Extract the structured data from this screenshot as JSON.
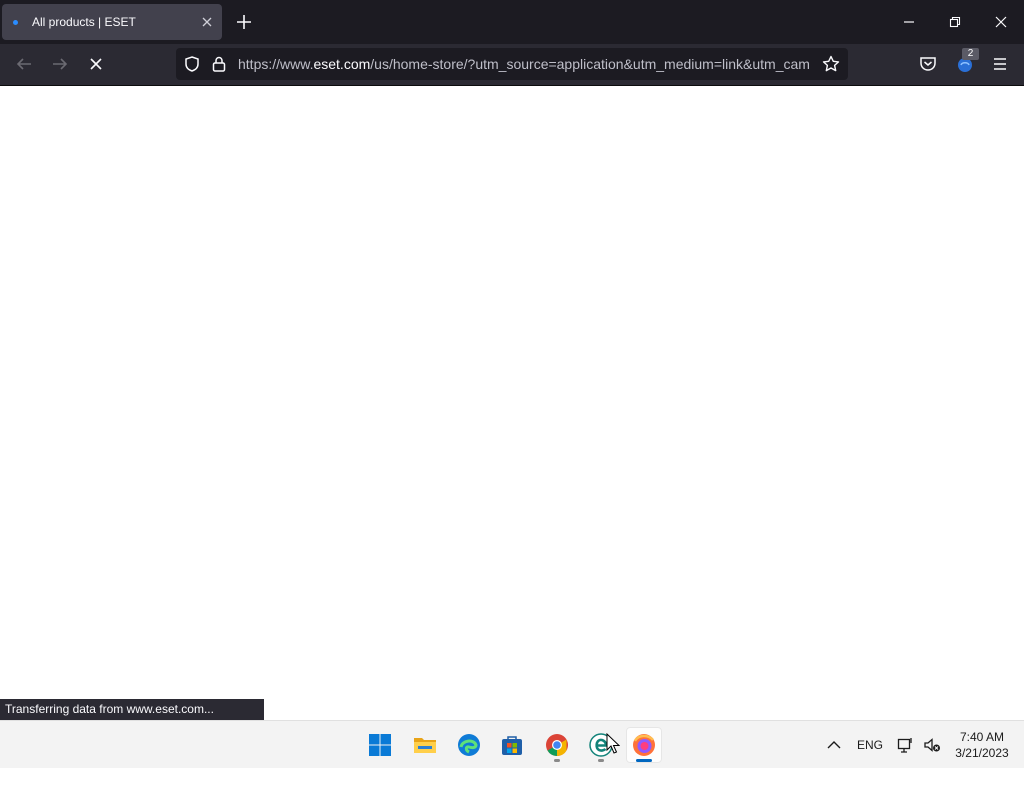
{
  "browser": {
    "tab": {
      "title": "All products | ESET"
    },
    "url": {
      "prefix": "https://www.",
      "host": "eset.com",
      "rest": "/us/home-store/?utm_source=application&utm_medium=link&utm_cam"
    },
    "extension_badge": "2",
    "status_text": "Transferring data from www.eset.com..."
  },
  "taskbar": {
    "language": "ENG",
    "time": "7:40 AM",
    "date": "3/21/2023"
  },
  "colors": {
    "tabbar_bg": "#1c1b22",
    "toolbar_bg": "#2b2a33",
    "accent": "#0067c0"
  }
}
